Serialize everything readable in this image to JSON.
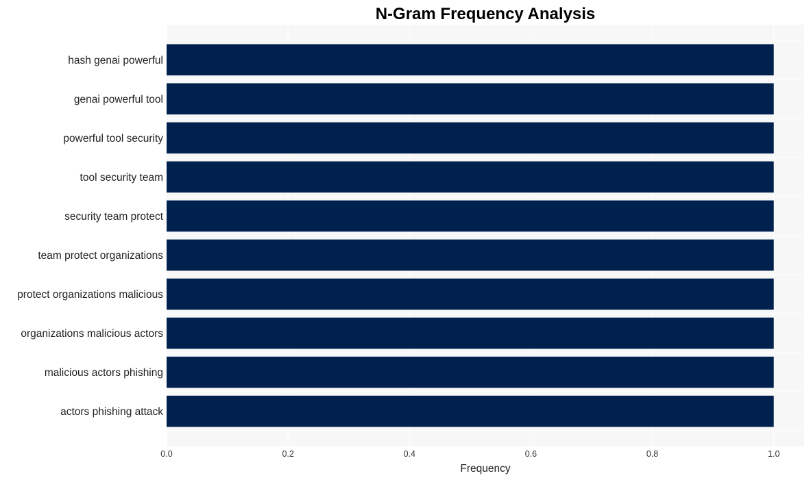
{
  "chart_data": {
    "type": "bar",
    "orientation": "horizontal",
    "title": "N-Gram Frequency Analysis",
    "xlabel": "Frequency",
    "ylabel": "",
    "categories": [
      "hash genai powerful",
      "genai powerful tool",
      "powerful tool security",
      "tool security team",
      "security team protect",
      "team protect organizations",
      "protect organizations malicious",
      "organizations malicious actors",
      "malicious actors phishing",
      "actors phishing attack"
    ],
    "values": [
      1,
      1,
      1,
      1,
      1,
      1,
      1,
      1,
      1,
      1
    ],
    "xlim": [
      0,
      1.05
    ],
    "xticks": [
      0.0,
      0.2,
      0.4,
      0.6,
      0.8,
      1.0
    ],
    "xtick_labels": [
      "0.0",
      "0.2",
      "0.4",
      "0.6",
      "0.8",
      "1.0"
    ],
    "grid": true,
    "legend": "none",
    "colors": {
      "bar": "#00214e",
      "plot_background": "#f7f7f7",
      "grid": "#ffffff"
    }
  }
}
